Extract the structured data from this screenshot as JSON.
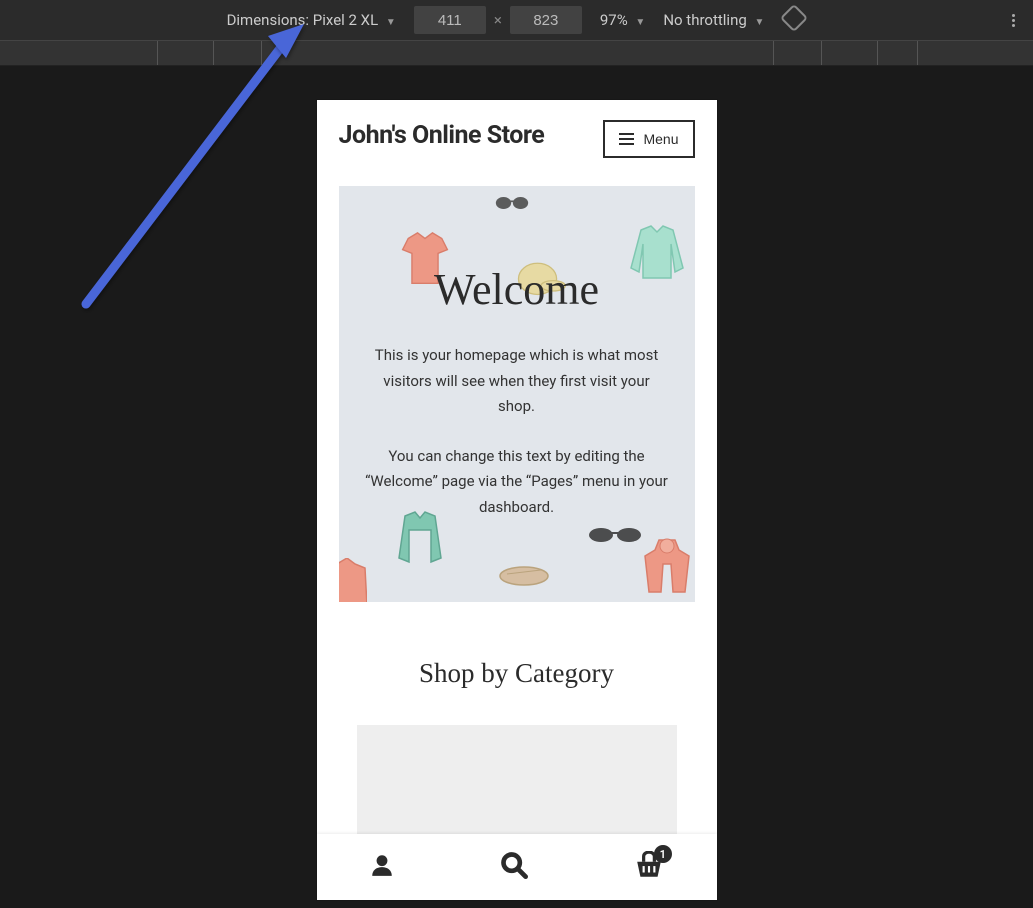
{
  "devtools": {
    "dimensions_label": "Dimensions:",
    "device_name": "Pixel 2 XL",
    "width": "411",
    "height": "823",
    "zoom": "97%",
    "throttling": "No throttling"
  },
  "site": {
    "title": "John's Online Store",
    "menu_label": "Menu",
    "hero": {
      "title": "Welcome",
      "paragraph1": "This is your homepage which is what most visitors will see when they first visit your shop.",
      "paragraph2": "You can change this text by editing the “Welcome” page via the “Pages” menu in your dashboard."
    },
    "shop_section_title": "Shop by Category",
    "cart_badge": "1"
  },
  "colors": {
    "arrow": "#4A66D8",
    "hero_bg": "#e2e6eb",
    "coral": "#f08b74",
    "mint": "#9fe0ca",
    "mustard": "#e8d997",
    "dark": "#2b2b2b"
  }
}
